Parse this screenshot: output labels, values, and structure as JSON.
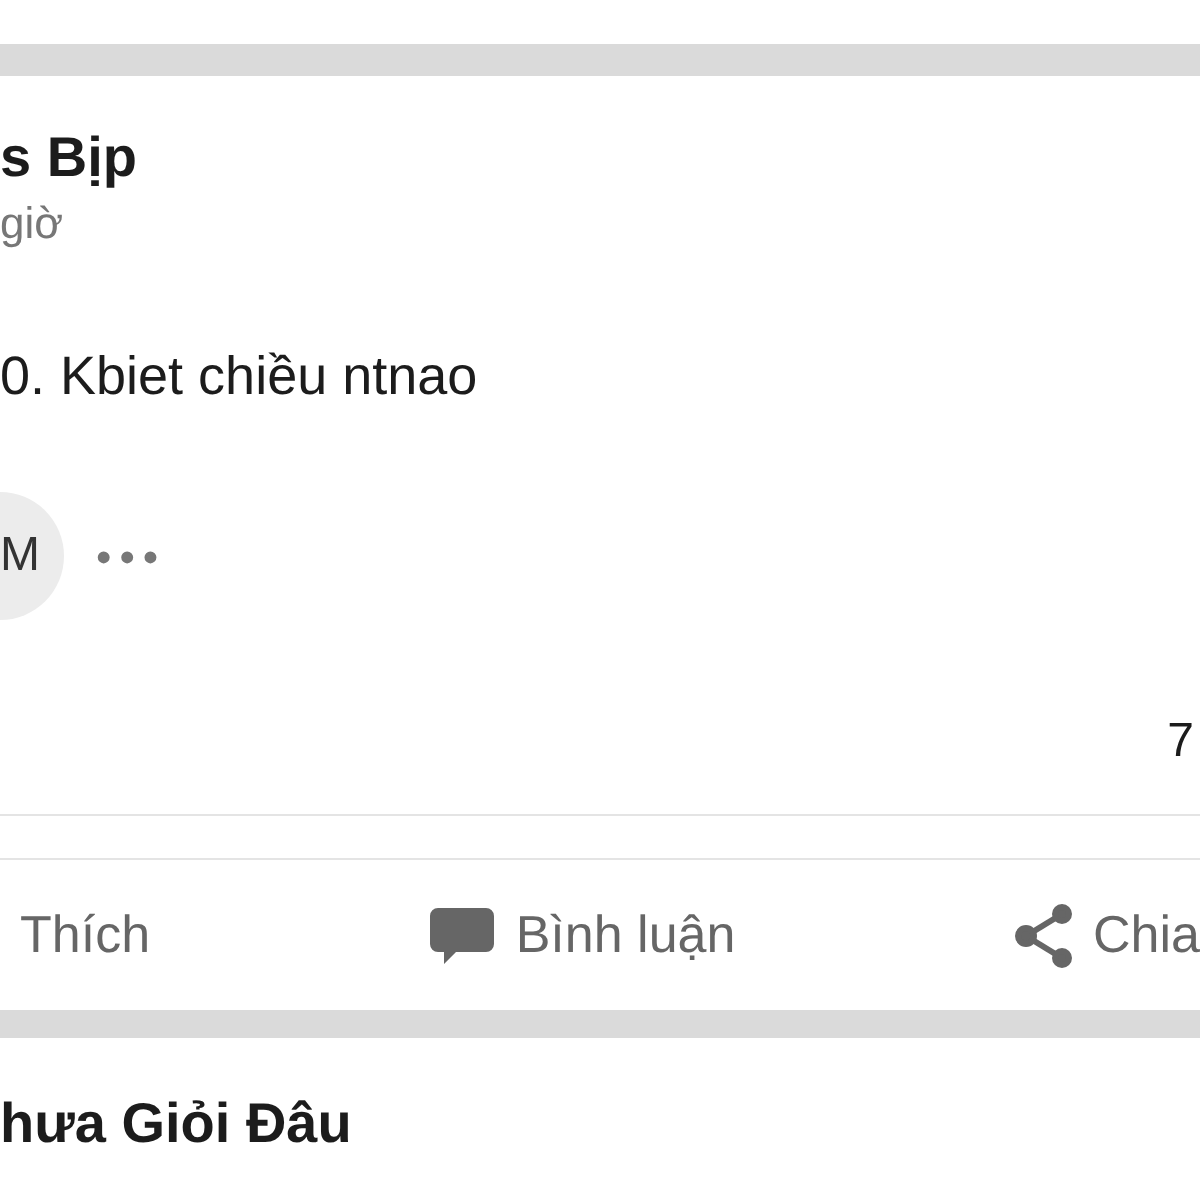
{
  "post": {
    "author": "s Bịp",
    "time": "giờ",
    "text": "0. Kbiet chiều ntnao",
    "avatar_letter": "M",
    "more": "•••",
    "count": "7",
    "actions": [
      {
        "kind": "like",
        "label": "Thích"
      },
      {
        "kind": "comment",
        "label": "Bình luận"
      },
      {
        "kind": "share",
        "label": "Chia"
      }
    ]
  },
  "next_post": {
    "author": "hưa Giỏi Đâu"
  }
}
